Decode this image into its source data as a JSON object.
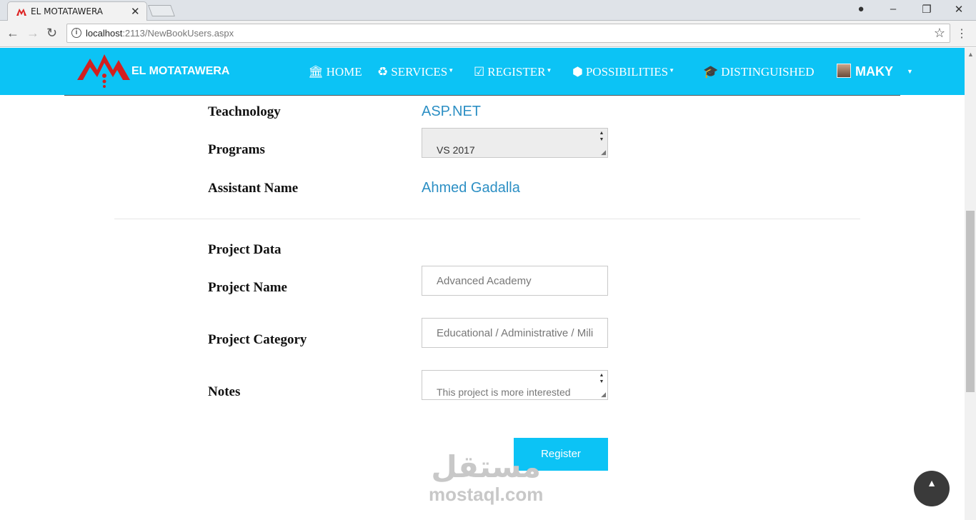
{
  "browser": {
    "tab_title": "EL MOTATAWERA",
    "url_host": "localhost",
    "url_path": ":2113/NewBookUsers.aspx"
  },
  "navbar": {
    "brand": "EL MOTATAWERA",
    "items": [
      {
        "label": "HOME",
        "icon": "bank-icon"
      },
      {
        "label": "SERVICES",
        "icon": "recycle-icon"
      },
      {
        "label": "REGISTER",
        "icon": "check-square-icon"
      },
      {
        "label": "POSSIBILITIES",
        "icon": "cubes-icon"
      },
      {
        "label": "DISTINGUISHED",
        "icon": "graduation-cap-icon"
      }
    ],
    "user": "MAKY"
  },
  "form": {
    "technology_label": "Teachnology",
    "technology_value": "ASP.NET",
    "programs_label": "Programs",
    "programs_value": "VS 2017",
    "assistant_label": "Assistant Name",
    "assistant_value": "Ahmed Gadalla",
    "project_section": "Project Data",
    "project_name_label": "Project Name",
    "project_name_value": "Advanced Academy",
    "project_category_label": "Project Category",
    "project_category_value": "Educational / Administrative / Mili",
    "notes_label": "Notes",
    "notes_value": "This project is more interested",
    "register_button": "Register"
  },
  "watermark": {
    "arabic": "مستقل",
    "latin": "mostaql.com"
  },
  "colors": {
    "accent": "#0cc3f5",
    "link": "#2c8fc4"
  }
}
